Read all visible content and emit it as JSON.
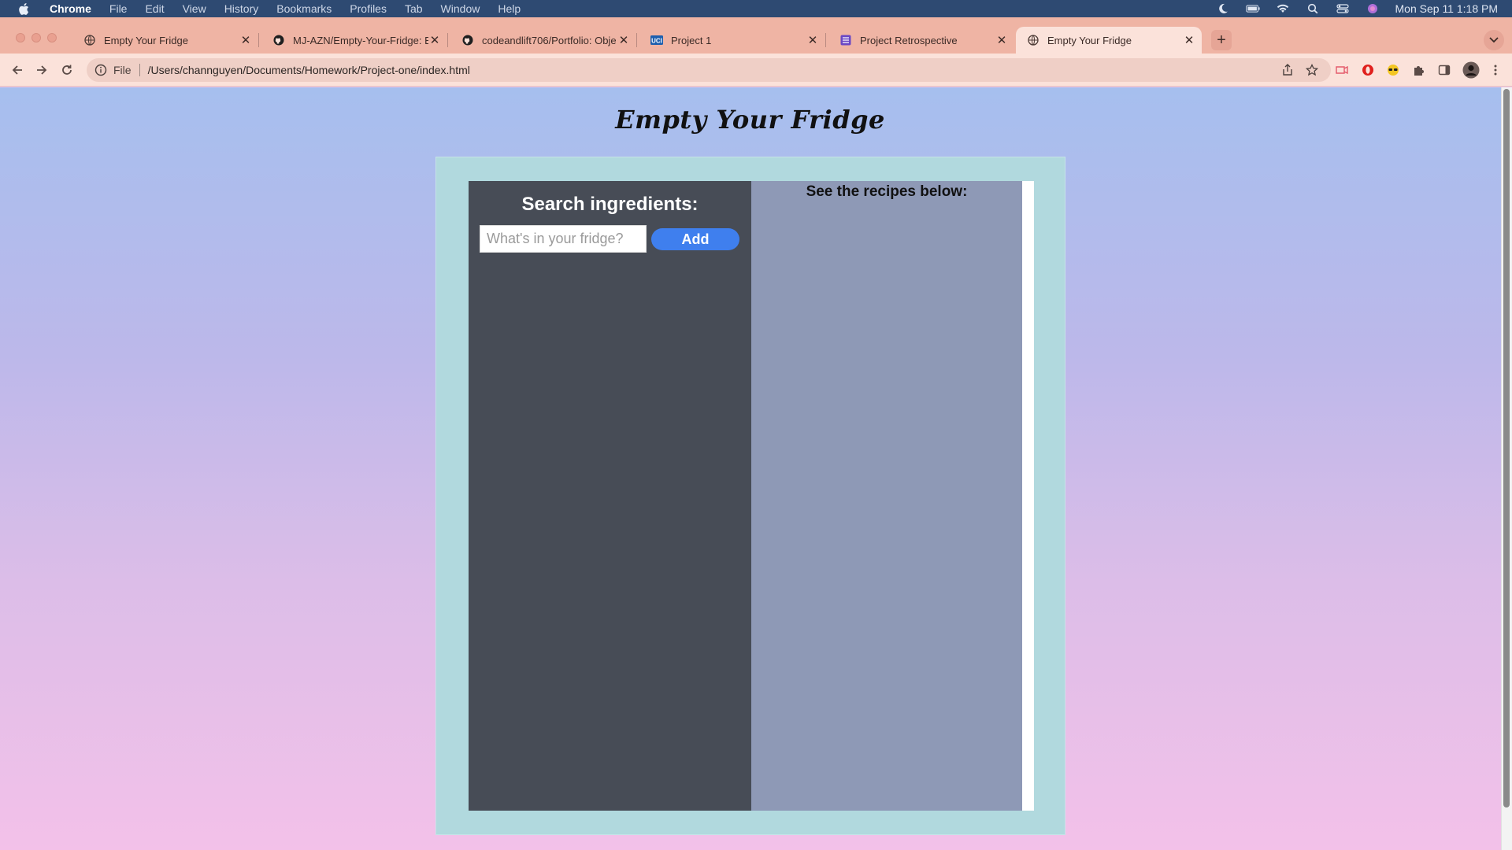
{
  "menubar": {
    "app": "Chrome",
    "items": [
      "File",
      "Edit",
      "View",
      "History",
      "Bookmarks",
      "Profiles",
      "Tab",
      "Window",
      "Help"
    ],
    "clock": "Mon Sep 11  1:18 PM"
  },
  "tabs": [
    {
      "title": "Empty Your Fridge",
      "favicon": "globe-icon"
    },
    {
      "title": "MJ-AZN/Empty-Your-Fridge: E",
      "favicon": "github-icon"
    },
    {
      "title": "codeandlift706/Portfolio: Obje",
      "favicon": "github-icon"
    },
    {
      "title": "Project 1",
      "favicon": "uci-icon"
    },
    {
      "title": "Project Retrospective",
      "favicon": "sheet-icon"
    },
    {
      "title": "Empty Your Fridge",
      "favicon": "globe-icon",
      "active": true
    }
  ],
  "toolbar": {
    "scheme": "File",
    "url": "/Users/channguyen/Documents/Homework/Project-one/index.html"
  },
  "page": {
    "title": "Empty Your Fridge",
    "search_heading": "Search ingredients:",
    "search_placeholder": "What's in your fridge?",
    "search_value": "",
    "add_label": "Add",
    "results_heading": "See the recipes below:"
  },
  "colors": {
    "accent": "#3f7fee",
    "left_panel": "#474c56",
    "right_panel": "#8e99b6",
    "container": "#b1d9de"
  }
}
